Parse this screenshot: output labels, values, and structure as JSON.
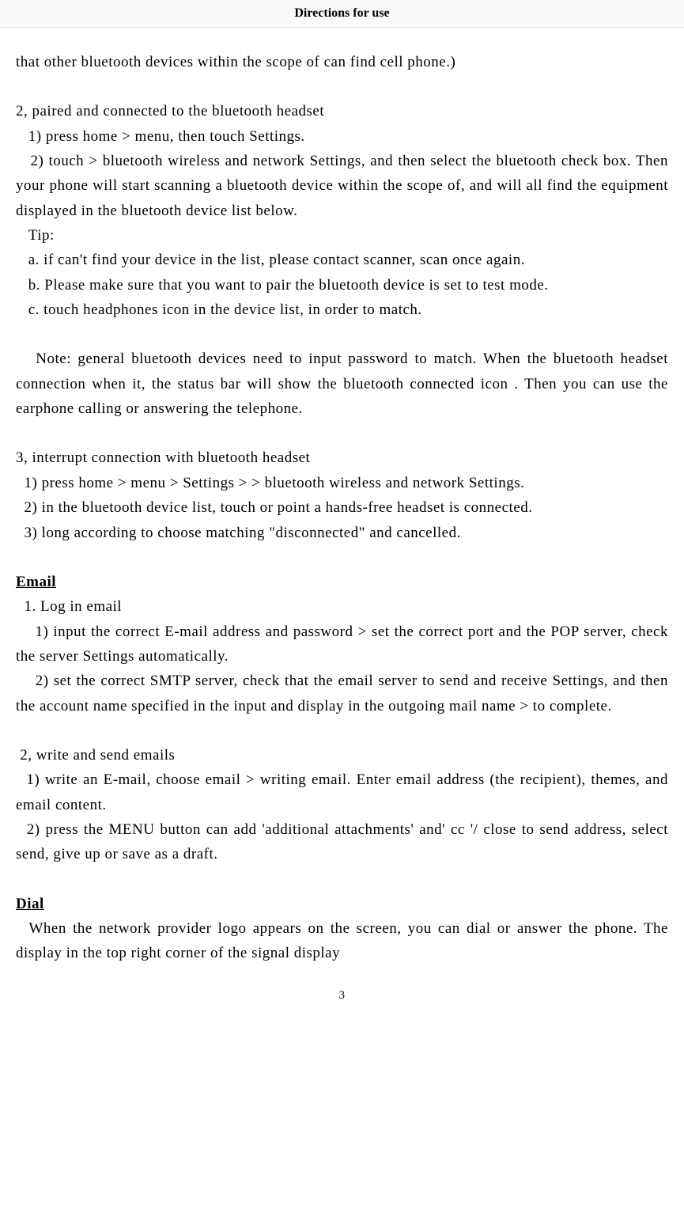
{
  "header": {
    "title": "Directions for use"
  },
  "body": {
    "p1": "that other bluetooth devices within the scope of can find cell phone.)",
    "p2": "2, paired and connected to the bluetooth headset",
    "p3": "   1) press home > menu, then touch Settings.",
    "p4": "   2) touch > bluetooth wireless and network Settings, and then select the bluetooth check box. Then your phone will start scanning a bluetooth device within the scope of, and will all find the equipment displayed in the bluetooth device list below.",
    "p5": "   Tip:",
    "p6": "   a. if can't find your device in the list, please contact scanner, scan once again.",
    "p7": "   b. Please make sure that you want to pair the bluetooth device is set to test mode.",
    "p8": "   c. touch headphones icon in the device list, in order to match.",
    "p9": "   Note: general bluetooth devices need to input password to match. When the bluetooth headset connection when it, the status bar will show the bluetooth connected icon . Then you can use the earphone calling or answering the telephone.",
    "p10": "3, interrupt connection with bluetooth headset",
    "p11": "  1) press home > menu > Settings > > bluetooth wireless and network Settings.",
    "p12": "  2) in the bluetooth device list, touch or point a hands-free headset is connected.",
    "p13": "  3) long according to choose matching \"disconnected\" and cancelled.",
    "h_email": "Email",
    "p14": "  1. Log in email",
    "p15": "    1) input the correct E-mail address and password > set the correct port and the POP server, check the server Settings automatically.",
    "p16": "    2) set the correct SMTP server, check that the email server to send and receive Settings, and then the account name specified in the input and display in the outgoing mail name > to complete.",
    "p17": " 2, write and send emails",
    "p18": "  1) write an E-mail, choose email > writing email. Enter email address (the recipient), themes, and email content.",
    "p19": "  2) press the MENU button can add 'additional attachments' and' cc '/ close to send address, select send, give up or save as a draft.",
    "h_dial": "Dial",
    "p20": "  When the network provider logo appears on the screen, you can dial or answer the phone. The display in the top right corner of the signal display"
  },
  "footer": {
    "page_number": "3"
  }
}
